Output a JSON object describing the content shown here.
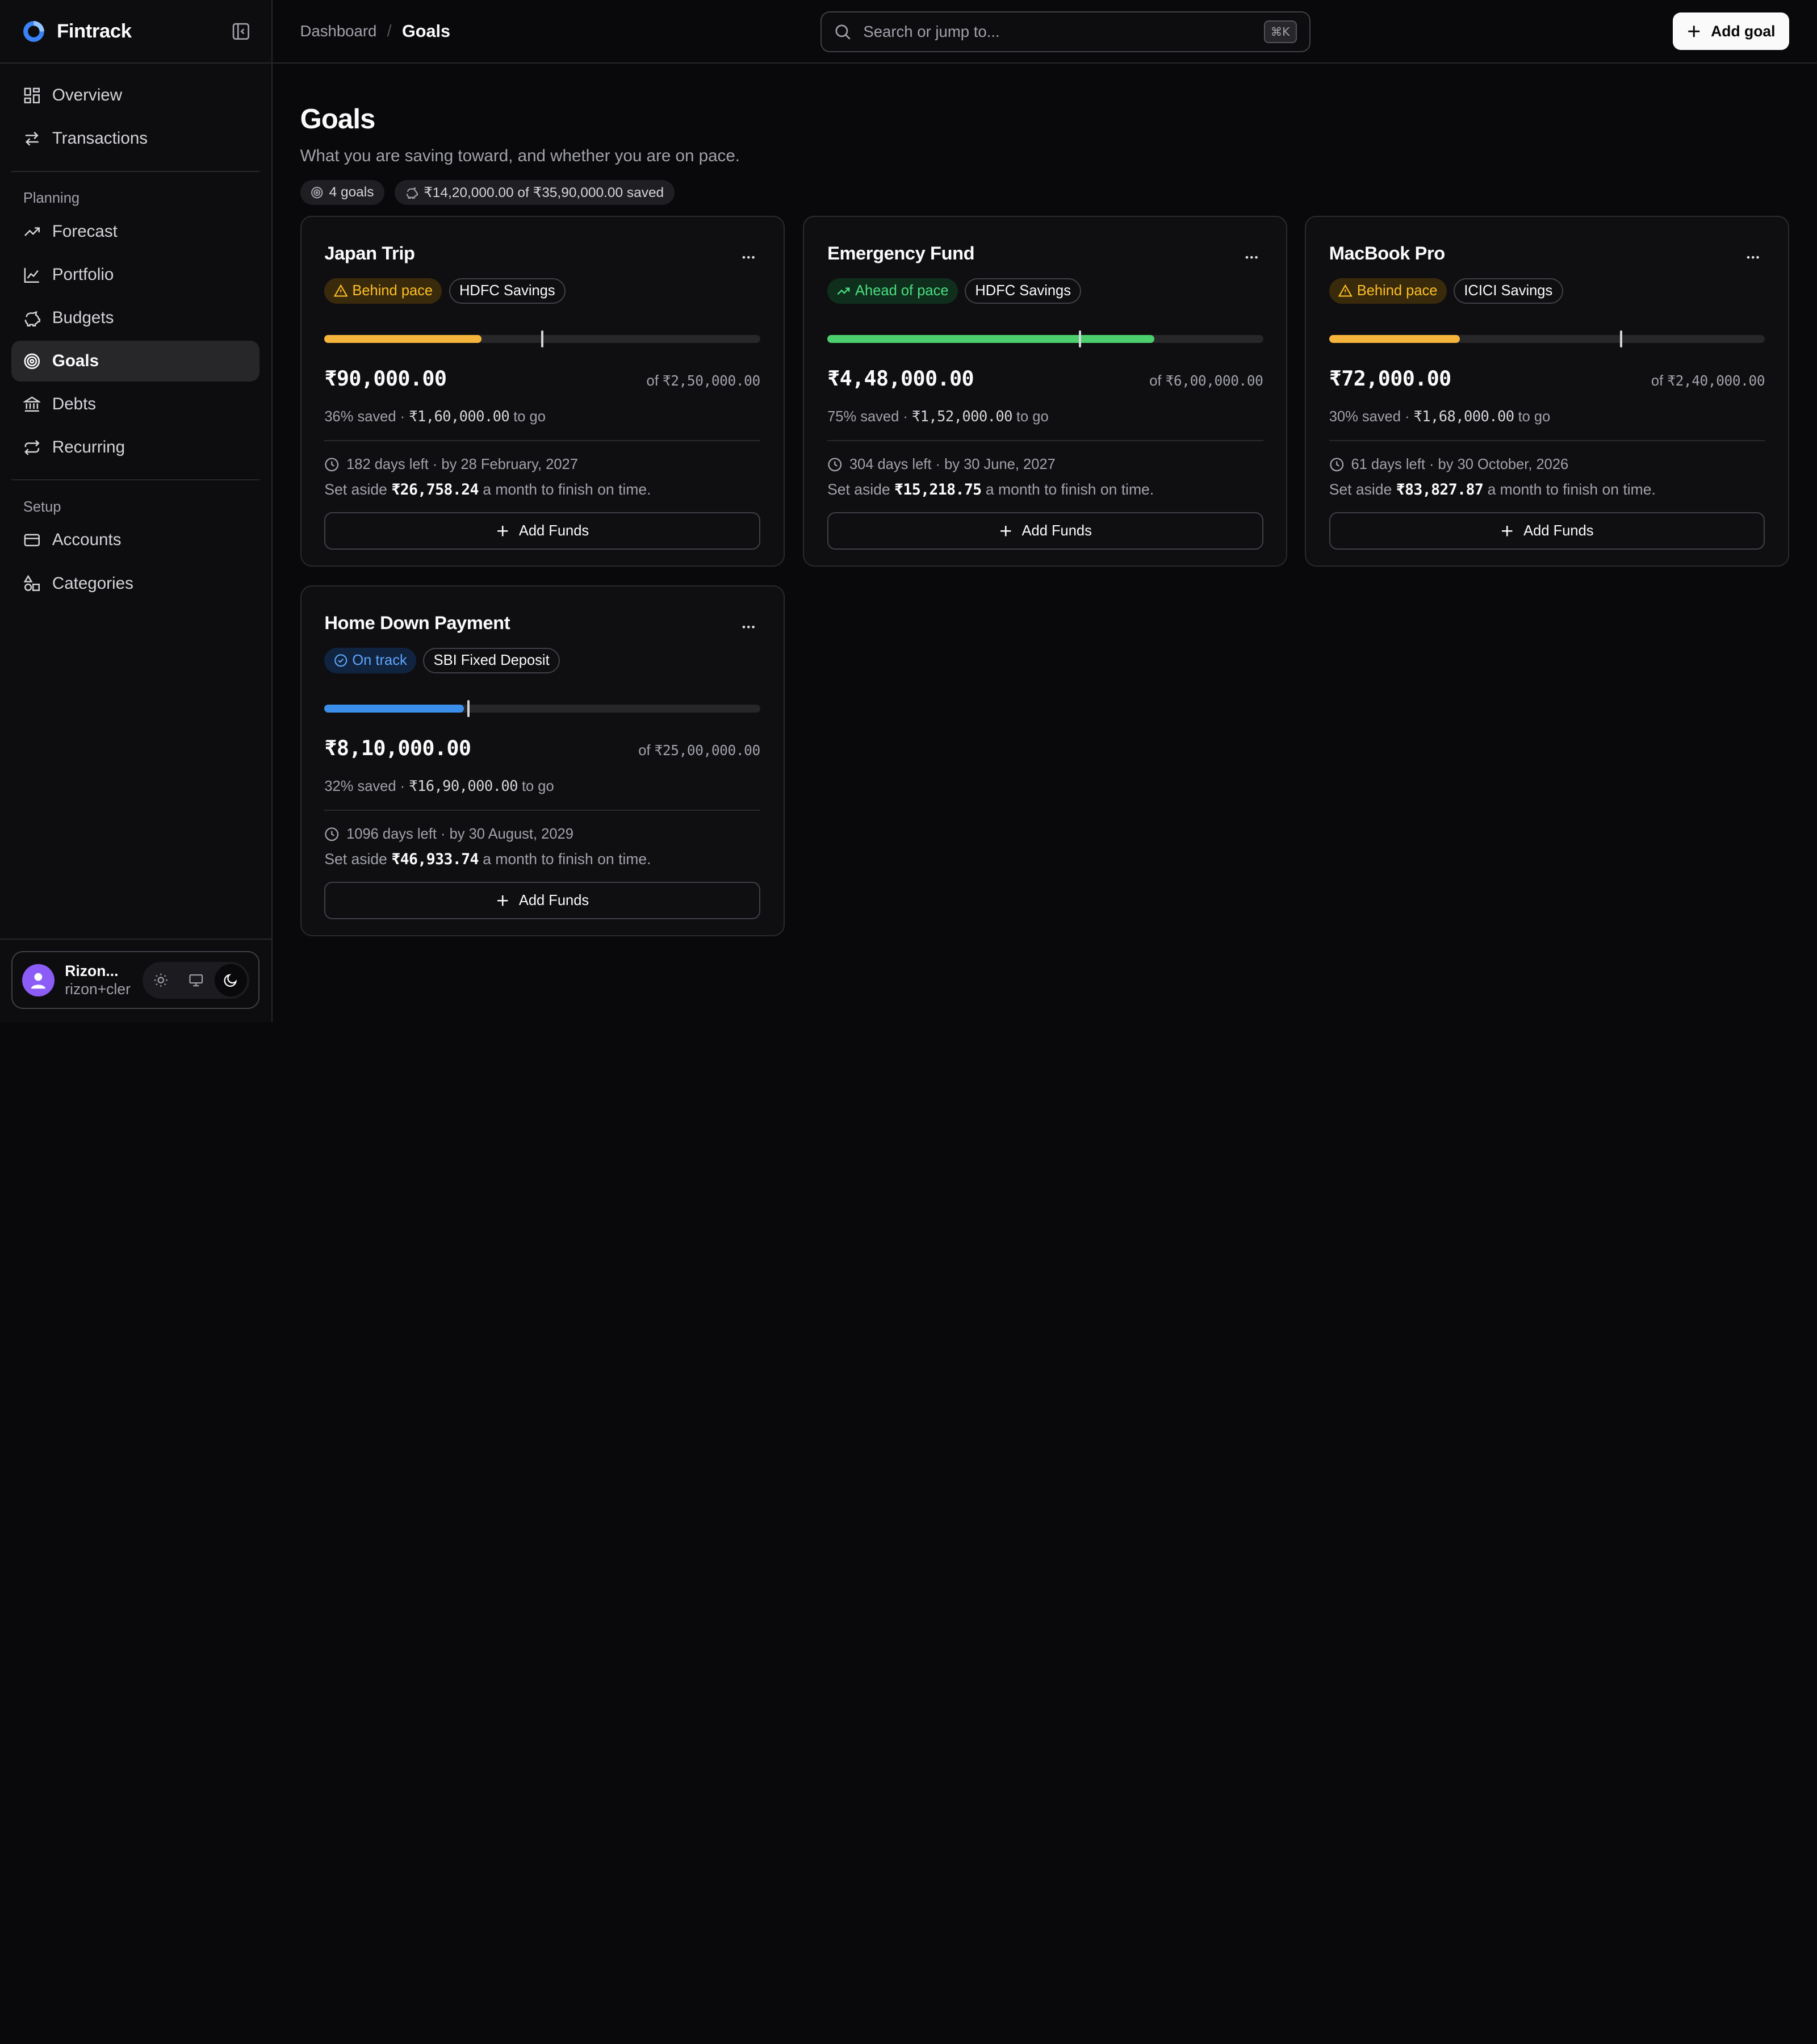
{
  "brand": {
    "name": "Fintrack"
  },
  "sidebar": {
    "main_items": [
      {
        "label": "Overview",
        "icon": "grid-icon"
      },
      {
        "label": "Transactions",
        "icon": "arrows-icon"
      }
    ],
    "planning_label": "Planning",
    "planning_items": [
      {
        "label": "Forecast",
        "icon": "trend-icon"
      },
      {
        "label": "Portfolio",
        "icon": "chart-line-icon"
      },
      {
        "label": "Budgets",
        "icon": "piggy-icon"
      },
      {
        "label": "Goals",
        "icon": "target-icon",
        "active": true
      },
      {
        "label": "Debts",
        "icon": "bank-icon"
      },
      {
        "label": "Recurring",
        "icon": "repeat-icon"
      }
    ],
    "setup_label": "Setup",
    "setup_items": [
      {
        "label": "Accounts",
        "icon": "card-icon"
      },
      {
        "label": "Categories",
        "icon": "shapes-icon"
      }
    ]
  },
  "user": {
    "name": "Rizon...",
    "email": "rizon+cler"
  },
  "breadcrumb": {
    "parent": "Dashboard",
    "separator": "/",
    "current": "Goals"
  },
  "search": {
    "placeholder": "Search or jump to...",
    "shortcut": "⌘K"
  },
  "header": {
    "add_goal_label": "Add goal"
  },
  "page": {
    "title": "Goals",
    "subtitle": "What you are saving toward, and whether you are on pace.",
    "goals_count": "4 goals",
    "total_saved": "₹14,20,000.00 of ₹35,90,000.00 saved"
  },
  "colors": {
    "warn": "#f5b43c",
    "ahead": "#4ccf6e",
    "ontrack": "#3b8eea"
  },
  "goals": [
    {
      "title": "Japan Trip",
      "status": "Behind pace",
      "status_kind": "warn",
      "account": "HDFC Savings",
      "progress": 0.36,
      "expected": 0.5,
      "amount": "₹90,000.00",
      "target_prefix": "of",
      "target": "₹2,50,000.00",
      "saved_pct": "36% saved ·",
      "remaining": "₹1,60,000.00",
      "to_go": "to go",
      "days": "182 days left · by 28 February, 2027",
      "set_aside_prefix": "Set aside",
      "monthly": "₹26,758.24",
      "set_aside_suffix": "a month to finish on time.",
      "add_funds": "Add Funds"
    },
    {
      "title": "Emergency Fund",
      "status": "Ahead of pace",
      "status_kind": "ahead",
      "account": "HDFC Savings",
      "progress": 0.75,
      "expected": 0.58,
      "amount": "₹4,48,000.00",
      "target_prefix": "of",
      "target": "₹6,00,000.00",
      "saved_pct": "75% saved ·",
      "remaining": "₹1,52,000.00",
      "to_go": "to go",
      "days": "304 days left · by 30 June, 2027",
      "set_aside_prefix": "Set aside",
      "monthly": "₹15,218.75",
      "set_aside_suffix": "a month to finish on time.",
      "add_funds": "Add Funds"
    },
    {
      "title": "MacBook Pro",
      "status": "Behind pace",
      "status_kind": "warn",
      "account": "ICICI Savings",
      "progress": 0.3,
      "expected": 0.67,
      "amount": "₹72,000.00",
      "target_prefix": "of",
      "target": "₹2,40,000.00",
      "saved_pct": "30% saved ·",
      "remaining": "₹1,68,000.00",
      "to_go": "to go",
      "days": "61 days left · by 30 October, 2026",
      "set_aside_prefix": "Set aside",
      "monthly": "₹83,827.87",
      "set_aside_suffix": "a month to finish on time.",
      "add_funds": "Add Funds"
    },
    {
      "title": "Home Down Payment",
      "status": "On track",
      "status_kind": "ontrack",
      "account": "SBI Fixed Deposit",
      "progress": 0.32,
      "expected": 0.33,
      "amount": "₹8,10,000.00",
      "target_prefix": "of",
      "target": "₹25,00,000.00",
      "saved_pct": "32% saved ·",
      "remaining": "₹16,90,000.00",
      "to_go": "to go",
      "days": "1096 days left · by 30 August, 2029",
      "set_aside_prefix": "Set aside",
      "monthly": "₹46,933.74",
      "set_aside_suffix": "a month to finish on time.",
      "add_funds": "Add Funds"
    }
  ]
}
